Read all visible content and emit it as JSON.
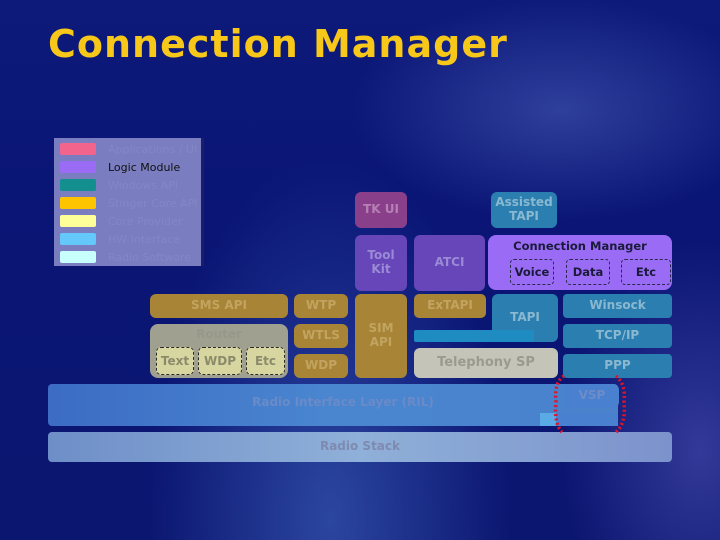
{
  "title": "Connection Manager",
  "legend": [
    {
      "label": "Applications / UI",
      "color": "#f2648c",
      "active": false
    },
    {
      "label": "Logic Module",
      "color": "#9a6cf6",
      "active": true
    },
    {
      "label": "Windows API",
      "color": "#148f8f",
      "active": false
    },
    {
      "label": "Stinger Core API",
      "color": "#ffc400",
      "active": false
    },
    {
      "label": "Core Provider",
      "color": "#ffff9a",
      "active": false
    },
    {
      "label": "HW Interface",
      "color": "#64c8fa",
      "active": false
    },
    {
      "label": "Radio Software",
      "color": "#c8ffff",
      "active": false
    }
  ],
  "blocks": {
    "tk_ui": "TK UI",
    "assisted_tapi": "Assisted TAPI",
    "tool_kit": "Tool Kit",
    "atci": "ATCI",
    "connection_manager": {
      "title": "Connection Manager",
      "items": [
        "Voice",
        "Data",
        "Etc"
      ]
    },
    "sms_api": "SMS API",
    "router": {
      "title": "Router",
      "items": [
        "Text",
        "WDP",
        "Etc"
      ]
    },
    "wtp": "WTP",
    "wtls": "WTLS",
    "wdp": "WDP",
    "sim_api": "SIM API",
    "extapi": "ExTAPI",
    "tapi": "TAPI",
    "winsock": "Winsock",
    "tcpip": "TCP/IP",
    "ppp": "PPP",
    "telephony_sp": "Telephony SP",
    "vsp": "VSP",
    "ril": "Radio Interface Layer (RIL)",
    "radio_stack": "Radio Stack"
  },
  "highlight_color": "#e0142a"
}
